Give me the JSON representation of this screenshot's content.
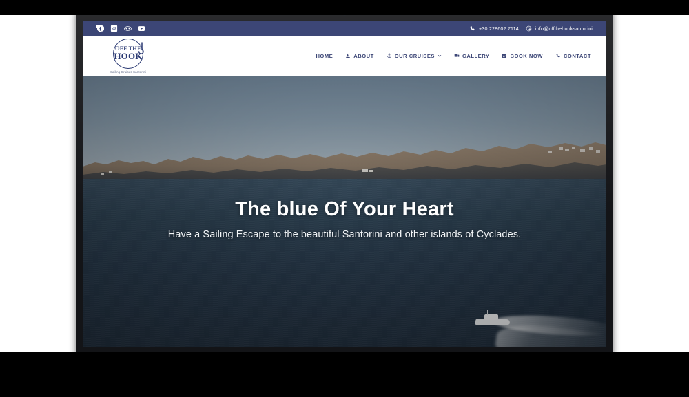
{
  "site": {
    "topbar": {
      "social": [
        {
          "name": "facebook-icon",
          "label": "Facebook"
        },
        {
          "name": "instagram-icon",
          "label": "Instagram"
        },
        {
          "name": "tripadvisor-icon",
          "label": "Tripadvisor"
        },
        {
          "name": "youtube-icon",
          "label": "YouTube"
        }
      ],
      "phone_icon": "phone-icon",
      "phone": "+30 228602 7114",
      "email_icon": "at-sign-icon",
      "email": "info@offthehooksantorini"
    },
    "logo": {
      "line1": "OFF THE",
      "line2": "HOOK",
      "tagline": "Sailing Cruises Santorini"
    },
    "nav": [
      {
        "label": "HOME",
        "icon": null,
        "caret": false
      },
      {
        "label": "ABOUT",
        "icon": "sailboat-icon",
        "caret": false
      },
      {
        "label": "OUR CRUISES",
        "icon": "anchor-icon",
        "caret": true
      },
      {
        "label": "GALLERY",
        "icon": "images-icon",
        "caret": false
      },
      {
        "label": "BOOK NOW",
        "icon": "calendar-icon",
        "caret": false
      },
      {
        "label": "CONTACT",
        "icon": "phone-icon",
        "caret": false
      }
    ],
    "hero": {
      "title": "The blue Of Your Heart",
      "subtitle": "Have a Sailing Escape to the beautiful Santorini and other islands of Cyclades."
    }
  },
  "colors": {
    "brand_navy": "#3c4676",
    "logo_navy": "#2b3a73",
    "navbar_bg": "#ffffff",
    "hero_sea": "#27384a",
    "letterbox": "#000000"
  }
}
